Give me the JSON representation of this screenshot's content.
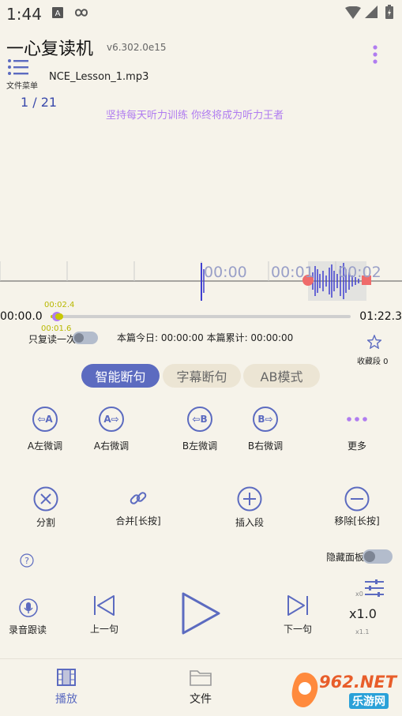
{
  "status": {
    "time": "1:44"
  },
  "header": {
    "title": "一心复读机",
    "version": "v6.302.0e15",
    "menu_label": "文件菜单",
    "filename": "NCE_Lesson_1.mp3",
    "counter": "1 / 21",
    "motto": "坚持每天听力训练 你终将成为听力王者"
  },
  "timeline": {
    "labels": [
      "00:00",
      "00:01",
      "00:02"
    ],
    "current_time": "00:00.0",
    "total_time": "01:22.3",
    "marker_time": "00:02.4",
    "marker_sub": "00:01.6",
    "progress": 0.02
  },
  "options": {
    "repeat_once_label": "只复读一次",
    "stats_text": "本篇今日: 00:00:00 本篇累计: 00:00:00",
    "favorites_label": "收藏段 0"
  },
  "mode_tabs": [
    {
      "label": "智能断句",
      "active": true
    },
    {
      "label": "字幕断句",
      "active": false
    },
    {
      "label": "AB模式",
      "active": false
    }
  ],
  "adjust": {
    "a_left_icon": "⇦A",
    "a_left": "A左微调",
    "a_right_icon": "A⇨",
    "a_right": "A右微调",
    "b_left_icon": "⇦B",
    "b_left": "B左微调",
    "b_right_icon": "B⇨",
    "b_right": "B右微调",
    "more": "更多"
  },
  "segment": {
    "split": "分割",
    "merge": "合并[长按]",
    "insert": "插入段",
    "remove": "移除[长按]"
  },
  "panel": {
    "hide_label": "隐藏面板"
  },
  "playback": {
    "record_follow": "录音跟读",
    "prev": "上一句",
    "next": "下一句",
    "speed": "x1.0",
    "speed_small_top": "x0",
    "speed_small_bottom": "x1.1"
  },
  "bottom_nav": [
    {
      "label": "播放",
      "active": true
    },
    {
      "label": "文件",
      "active": false
    }
  ],
  "watermark": {
    "text": "962.NET",
    "sub": "乐游网"
  },
  "colors": {
    "accent": "#5c6bc0",
    "purple": "#b07cf0",
    "waveform": "#3f3fd0",
    "ab_marker": "#ef6b6b"
  }
}
